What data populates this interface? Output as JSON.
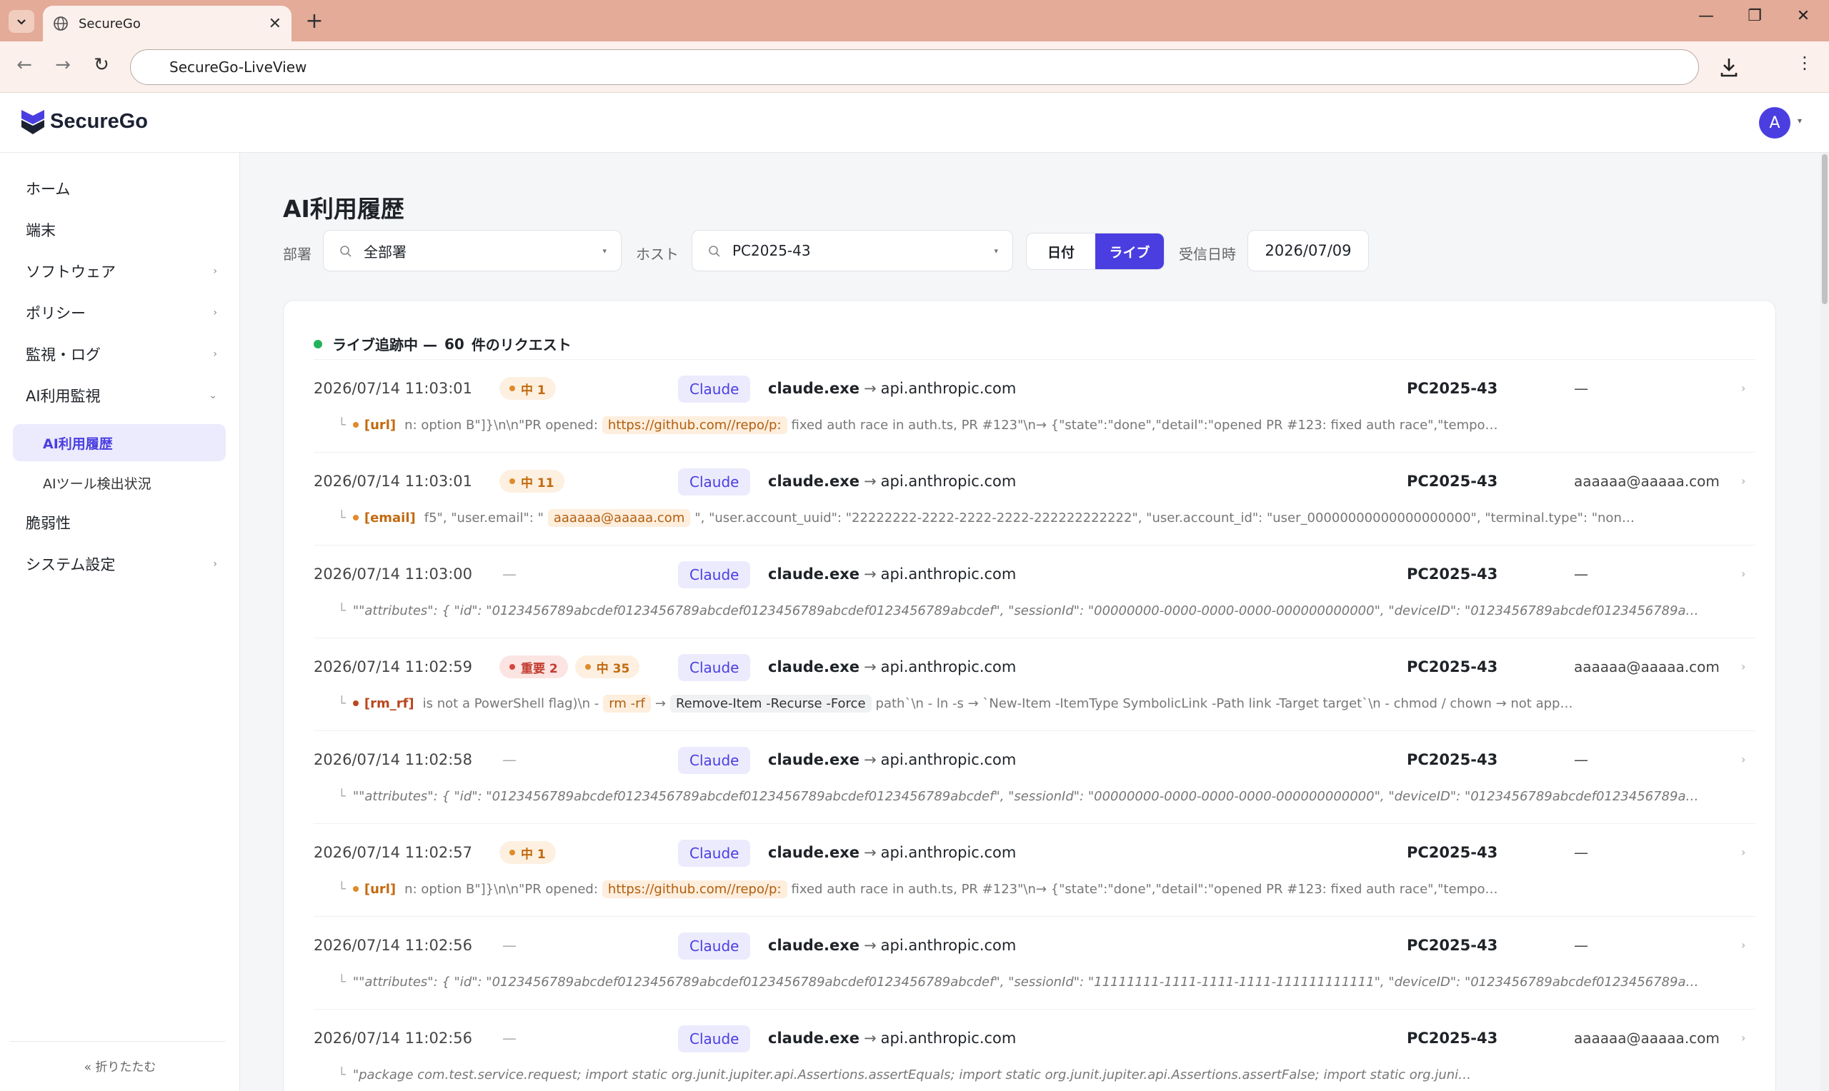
{
  "browser": {
    "tab_title": "SecureGo",
    "address": "SecureGo-LiveView"
  },
  "app": {
    "brand": "SecureGo",
    "avatar_initial": "A",
    "accent_color": "#4a3ee0"
  },
  "sidebar": {
    "items": [
      {
        "label": "ホーム"
      },
      {
        "label": "端末"
      },
      {
        "label": "ソフトウェア"
      },
      {
        "label": "ポリシー"
      },
      {
        "label": "監視・ログ"
      },
      {
        "label": "AI利用監視"
      },
      {
        "label": "AI利用履歴"
      },
      {
        "label": "AIツール検出状況"
      },
      {
        "label": "脆弱性"
      },
      {
        "label": "システム設定"
      }
    ],
    "collapse_label": "« 折りたたむ"
  },
  "page": {
    "title": "AI利用履歴",
    "filters": {
      "dept_label": "部署",
      "dept_value": "全部署",
      "host_label": "ホスト",
      "host_value": "PC2025-43",
      "mode_date": "日付",
      "mode_live": "ライブ",
      "received_label": "受信日時",
      "received_value": "2026/07/09"
    },
    "live": {
      "prefix": "ライブ追跡中 —",
      "count": "60",
      "suffix": "件のリクエスト"
    }
  },
  "rows": [
    {
      "time": "2026/07/14 11:03:01",
      "badges": [
        {
          "text": "中 1"
        }
      ],
      "tool": "Claude",
      "process": "claude.exe",
      "target": "api.anthropic.com",
      "host": "PC2025-43",
      "user": "—",
      "detail": {
        "kind": "[url]",
        "pre": "n: option B\"]}\\n\\n\"PR opened:",
        "hl": "https://github.com//repo/p:",
        "post": "fixed auth race in auth.ts, PR #123\"\\n→ {\"state\":\"done\",\"detail\":\"opened PR #123: fixed auth race\",\"tempo…"
      }
    },
    {
      "time": "2026/07/14 11:03:01",
      "badges": [
        {
          "text": "中 11"
        }
      ],
      "tool": "Claude",
      "process": "claude.exe",
      "target": "api.anthropic.com",
      "host": "PC2025-43",
      "user": "aaaaaa@aaaaa.com",
      "detail": {
        "kind": "[email]",
        "pre": "f5\", \"user.email\": \"",
        "hl": "aaaaaa@aaaaa.com",
        "post": "\", \"user.account_uuid\": \"22222222-2222-2222-2222-222222222222\", \"user.account_id\": \"user_00000000000000000000\", \"terminal.type\": \"non…"
      }
    },
    {
      "time": "2026/07/14 11:03:00",
      "tool": "Claude",
      "process": "claude.exe",
      "target": "api.anthropic.com",
      "host": "PC2025-43",
      "user": "—",
      "detail": {
        "text": "\"\"attributes\": { \"id\": \"0123456789abcdef0123456789abcdef0123456789abcdef0123456789abcdef\", \"sessionId\": \"00000000-0000-0000-0000-000000000000\", \"deviceID\": \"0123456789abcdef0123456789a…"
      }
    },
    {
      "time": "2026/07/14 11:02:59",
      "badges": [
        {
          "text": "重要 2",
          "level": "high"
        },
        {
          "text": "中 35"
        }
      ],
      "tool": "Claude",
      "process": "claude.exe",
      "target": "api.anthropic.com",
      "host": "PC2025-43",
      "user": "aaaaaa@aaaaa.com",
      "detail": {
        "kind": "[rm_rf]",
        "pre": "is not a PowerShell flag)\\n -",
        "hl": "rm -rf",
        "mid": "→",
        "gray": "Remove-Item -Recurse -Force",
        "post": "path`\\n - ln -s → `New-Item -ItemType SymbolicLink -Path link -Target target`\\n - chmod / chown → not app…"
      }
    },
    {
      "time": "2026/07/14 11:02:58",
      "tool": "Claude",
      "process": "claude.exe",
      "target": "api.anthropic.com",
      "host": "PC2025-43",
      "user": "—",
      "detail": {
        "text": "\"\"attributes\": { \"id\": \"0123456789abcdef0123456789abcdef0123456789abcdef0123456789abcdef\", \"sessionId\": \"00000000-0000-0000-0000-000000000000\", \"deviceID\": \"0123456789abcdef0123456789a…"
      }
    },
    {
      "time": "2026/07/14 11:02:57",
      "badges": [
        {
          "text": "中 1"
        }
      ],
      "tool": "Claude",
      "process": "claude.exe",
      "target": "api.anthropic.com",
      "host": "PC2025-43",
      "user": "—",
      "detail": {
        "kind": "[url]",
        "pre": "n: option B\"]}\\n\\n\"PR opened:",
        "hl": "https://github.com//repo/p:",
        "post": "fixed auth race in auth.ts, PR #123\"\\n→ {\"state\":\"done\",\"detail\":\"opened PR #123: fixed auth race\",\"tempo…"
      }
    },
    {
      "time": "2026/07/14 11:02:56",
      "tool": "Claude",
      "process": "claude.exe",
      "target": "api.anthropic.com",
      "host": "PC2025-43",
      "user": "—",
      "detail": {
        "text": "\"\"attributes\": { \"id\": \"0123456789abcdef0123456789abcdef0123456789abcdef0123456789abcdef\", \"sessionId\": \"11111111-1111-1111-1111-111111111111\", \"deviceID\": \"0123456789abcdef0123456789a…"
      }
    },
    {
      "time": "2026/07/14 11:02:56",
      "tool": "Claude",
      "process": "claude.exe",
      "target": "api.anthropic.com",
      "host": "PC2025-43",
      "user": "aaaaaa@aaaaa.com",
      "detail": {
        "text": "\"package com.test.service.request; import static org.junit.jupiter.api.Assertions.assertEquals; import static org.junit.jupiter.api.Assertions.assertFalse; import static org.juni…"
      }
    }
  ]
}
